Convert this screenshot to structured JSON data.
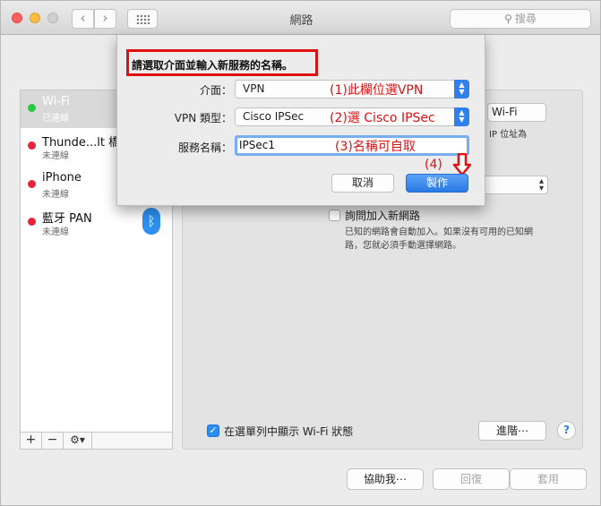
{
  "window": {
    "title": "網路",
    "search_placeholder": "搜尋",
    "icons": {
      "back": "chevron-left-icon",
      "forward": "chevron-right-icon",
      "grid": "grid-icon",
      "search": "search-icon"
    }
  },
  "sidebar": {
    "services": [
      {
        "name": "Wi-Fi",
        "status": "已連線",
        "state": "connected",
        "selected": true
      },
      {
        "name": "Thunde...lt 橋接",
        "status": "未連線",
        "state": "disconnected"
      },
      {
        "name": "iPhone",
        "status": "未連線",
        "state": "disconnected"
      },
      {
        "name": "藍牙 PAN",
        "status": "未連線",
        "state": "disconnected",
        "icon": "bluetooth-icon"
      }
    ],
    "footer": {
      "add": "+",
      "remove": "−",
      "gear": "⚙▾"
    }
  },
  "pane": {
    "wifi_button": "Wi-Fi",
    "ip_text": "IP 位址為",
    "ask_join_label": "詢問加入新網路",
    "ask_join_desc": "已知的網路會自動加入。如果沒有可用的已知網路，您就必須手動選擇網路。",
    "show_wifi_status": "在選單列中顯示 Wi-Fi 狀態",
    "advanced_button": "進階⋯",
    "help_button": "?"
  },
  "bottom_buttons": {
    "assist": "協助我⋯",
    "revert": "回復",
    "apply": "套用"
  },
  "sheet": {
    "prompt": "請選取介面並輸入新服務的名稱。",
    "interface_label": "介面：",
    "interface_value": "VPN",
    "vpn_type_label": "VPN 類型：",
    "vpn_type_value": "Cisco IPSec",
    "service_name_label": "服務名稱：",
    "service_name_value": "IPSec1",
    "cancel_button": "取消",
    "create_button": "製作"
  },
  "annotations": {
    "step1": "(1)此欄位選VPN",
    "step2": "(2)選 Cisco IPSec",
    "step3": "(3)名稱可自取",
    "step4": "(4)"
  },
  "colors": {
    "annotation": "#e01010",
    "accent": "#2f80e8",
    "connected": "#27c93f",
    "disconnected": "#e8233c"
  }
}
